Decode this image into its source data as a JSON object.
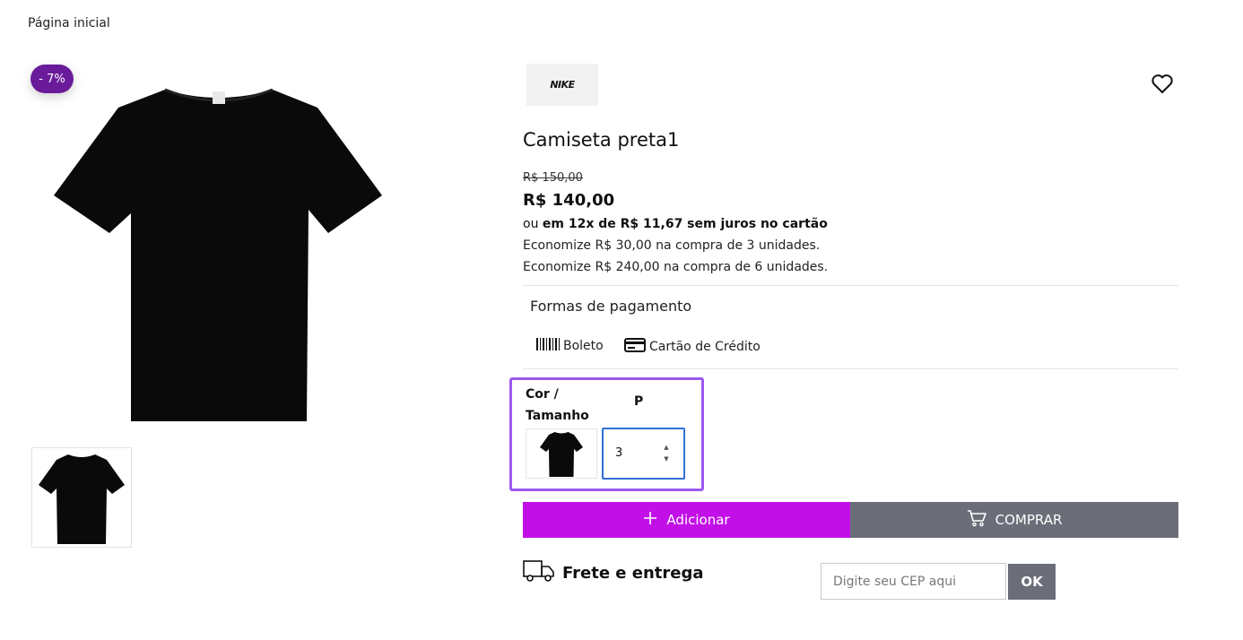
{
  "breadcrumb": {
    "label": "Página inicial"
  },
  "product": {
    "discount_badge": "- 7%",
    "brand": "NIKE",
    "title": "Camiseta preta1",
    "old_price": "R$ 150,00",
    "price": "R$ 140,00",
    "installment_prefix": "ou ",
    "installment_bold": "em 12x de R$ 11,67 sem juros no cartão",
    "economy_lines": [
      "Economize R$ 30,00 na compra de 3 unidades.",
      "Economize R$ 240,00 na compra de 6 unidades."
    ]
  },
  "payment": {
    "title": "Formas de pagamento",
    "methods": [
      {
        "label": "Boleto",
        "icon": "barcode-icon"
      },
      {
        "label": "Cartão de Crédito",
        "icon": "credit-card-icon"
      }
    ]
  },
  "variants": {
    "header": "Cor / Tamanho",
    "sizes": [
      "P"
    ],
    "quantity": "3"
  },
  "actions": {
    "add_label": "Adicionar",
    "buy_label": "COMPRAR"
  },
  "shipping": {
    "label": "Frete e entrega",
    "cep_placeholder": "Digite seu CEP aqui",
    "ok_label": "OK"
  },
  "colors": {
    "accent": "#c20fe8",
    "badge": "#6a1b9a",
    "gray_button": "#6b6e79",
    "focus_border": "#9b59f0"
  }
}
